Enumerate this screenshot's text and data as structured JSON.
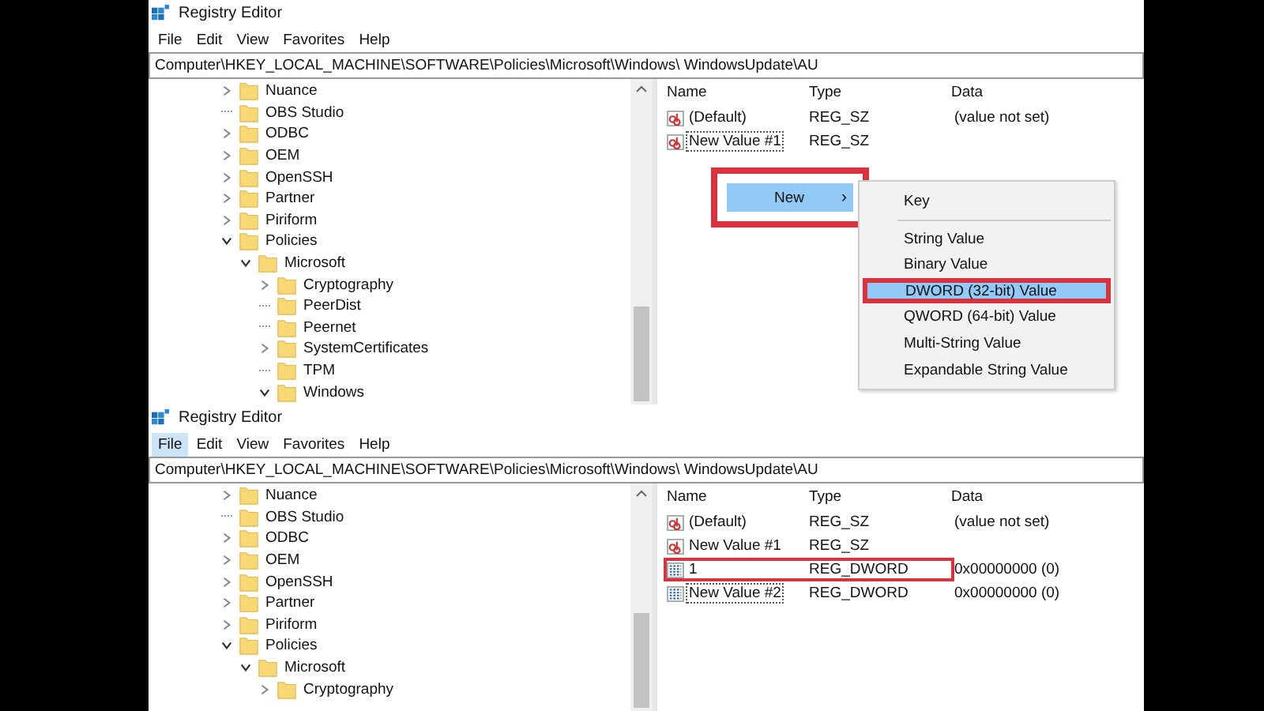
{
  "windows": [
    {
      "title": "Registry Editor",
      "menu": [
        {
          "label": "File",
          "selected": false
        },
        {
          "label": "Edit",
          "selected": false
        },
        {
          "label": "View",
          "selected": false
        },
        {
          "label": "Favorites",
          "selected": false
        },
        {
          "label": "Help",
          "selected": false
        }
      ],
      "address": "Computer\\HKEY_LOCAL_MACHINE\\SOFTWARE\\Policies\\Microsoft\\Windows\\ WindowsUpdate\\AU",
      "tree": [
        {
          "label": "Nuance",
          "expanded": false
        },
        {
          "label": "OBS Studio"
        },
        {
          "label": "ODBC",
          "expanded": false
        },
        {
          "label": "OEM",
          "expanded": false
        },
        {
          "label": "OpenSSH",
          "expanded": false
        },
        {
          "label": "Partner",
          "expanded": false
        },
        {
          "label": "Piriform",
          "expanded": false
        },
        {
          "label": "Policies",
          "expanded": true,
          "children": [
            {
              "label": "Microsoft",
              "expanded": true,
              "children": [
                {
                  "label": "Cryptography",
                  "expanded": false
                },
                {
                  "label": "PeerDist"
                },
                {
                  "label": "Peernet"
                },
                {
                  "label": "SystemCertificates",
                  "expanded": false
                },
                {
                  "label": "TPM"
                },
                {
                  "label": "Windows",
                  "expanded": true
                }
              ]
            }
          ]
        }
      ],
      "columns": [
        "Name",
        "Type",
        "Data"
      ],
      "values": [
        {
          "kind": "string",
          "name": "(Default)",
          "type": "REG_SZ",
          "data": "(value not set)",
          "editing": false,
          "highlighted": false
        },
        {
          "kind": "string",
          "name": "New Value #1",
          "type": "REG_SZ",
          "editing": true,
          "highlighted": false
        }
      ],
      "context_menu": {
        "items": [
          {
            "label": "New",
            "arrow": "›",
            "selected": true,
            "highlighted": true
          }
        ],
        "submenu": [
          {
            "label": "Key",
            "selected": false,
            "highlighted": false,
            "separator_after": true
          },
          {
            "label": "String Value",
            "selected": false,
            "highlighted": false,
            "separator_after": false
          },
          {
            "label": "Binary Value",
            "selected": false,
            "highlighted": false,
            "separator_after": false
          },
          {
            "label": "DWORD (32-bit) Value",
            "selected": true,
            "highlighted": true,
            "separator_after": false
          },
          {
            "label": "QWORD (64-bit) Value",
            "selected": false,
            "highlighted": false,
            "separator_after": false
          },
          {
            "label": "Multi-String Value",
            "selected": false,
            "highlighted": false,
            "separator_after": false
          },
          {
            "label": "Expandable String Value",
            "selected": false,
            "highlighted": false,
            "separator_after": false
          }
        ]
      }
    },
    {
      "title": "Registry Editor",
      "menu": [
        {
          "label": "File",
          "selected": true
        },
        {
          "label": "Edit",
          "selected": false
        },
        {
          "label": "View",
          "selected": false
        },
        {
          "label": "Favorites",
          "selected": false
        },
        {
          "label": "Help",
          "selected": false
        }
      ],
      "address": "Computer\\HKEY_LOCAL_MACHINE\\SOFTWARE\\Policies\\Microsoft\\Windows\\ WindowsUpdate\\AU",
      "tree": [
        {
          "label": "Nuance",
          "expanded": false
        },
        {
          "label": "OBS Studio"
        },
        {
          "label": "ODBC",
          "expanded": false
        },
        {
          "label": "OEM",
          "expanded": false
        },
        {
          "label": "OpenSSH",
          "expanded": false
        },
        {
          "label": "Partner",
          "expanded": false
        },
        {
          "label": "Piriform",
          "expanded": false
        },
        {
          "label": "Policies",
          "expanded": true,
          "children": [
            {
              "label": "Microsoft",
              "expanded": true,
              "children": [
                {
                  "label": "Cryptography",
                  "expanded": false
                }
              ]
            }
          ]
        }
      ],
      "columns": [
        "Name",
        "Type",
        "Data"
      ],
      "values": [
        {
          "kind": "string",
          "name": "(Default)",
          "type": "REG_SZ",
          "data": "(value not set)",
          "editing": false,
          "highlighted": false
        },
        {
          "kind": "string",
          "name": "New Value #1",
          "type": "REG_SZ",
          "editing": false,
          "highlighted": false
        },
        {
          "kind": "dword",
          "name": "1",
          "type": "REG_DWORD",
          "data": "0x00000000 (0)",
          "editing": false,
          "highlighted": true
        },
        {
          "kind": "dword",
          "name": "New Value #2",
          "type": "REG_DWORD",
          "data": "0x00000000 (0)",
          "editing": true,
          "highlighted": false
        }
      ]
    }
  ]
}
